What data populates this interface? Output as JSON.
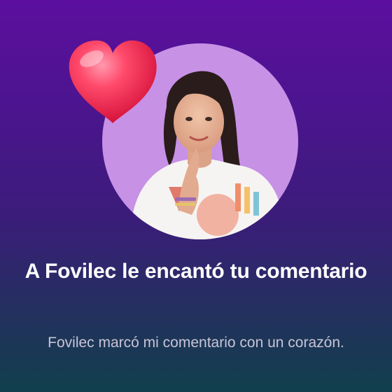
{
  "notification": {
    "title": "A Fovilec le encantó tu comentario",
    "subtitle": "Fovilec marcó mi comentario con un corazón.",
    "reaction_icon": "heart-icon",
    "avatar_alt": "Fovilec"
  },
  "colors": {
    "background_top": "#5c0f9e",
    "background_bottom": "#113f4c",
    "avatar_ring": "#c791e6",
    "heart": "#ff2d55",
    "title_text": "#ffffff",
    "subtitle_text": "#c8c4d6"
  }
}
